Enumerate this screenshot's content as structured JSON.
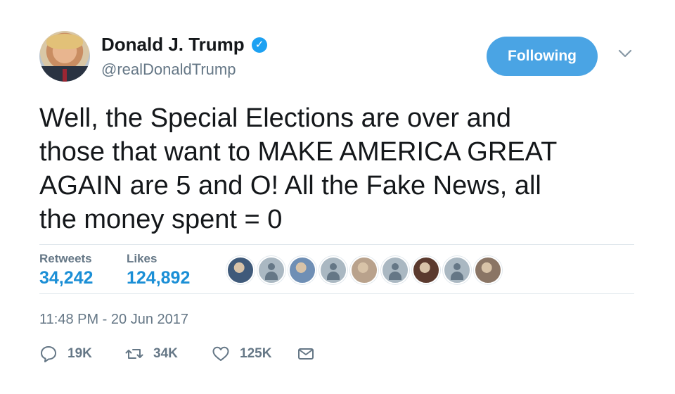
{
  "user": {
    "name": "Donald J. Trump",
    "handle": "@realDonaldTrump",
    "verified_glyph": "✓"
  },
  "follow": {
    "label": "Following"
  },
  "tweet": {
    "text": "Well, the Special Elections are over and\nthose that want to MAKE AMERICA GREAT\nAGAIN are 5 and O! All the Fake News, all\nthe money spent = 0"
  },
  "stats": {
    "retweets_label": "Retweets",
    "retweets_value": "34,242",
    "likes_label": "Likes",
    "likes_value": "124,892"
  },
  "likers": [
    {
      "kind": "photo",
      "color": "#3f5a7a"
    },
    {
      "kind": "default"
    },
    {
      "kind": "photo",
      "color": "#6f8fb5"
    },
    {
      "kind": "default"
    },
    {
      "kind": "photo",
      "color": "#b9a28c"
    },
    {
      "kind": "default"
    },
    {
      "kind": "photo",
      "color": "#5b3a2e"
    },
    {
      "kind": "default"
    },
    {
      "kind": "photo",
      "color": "#8a7565"
    }
  ],
  "timestamp": "11:48 PM - 20 Jun 2017",
  "actions": {
    "reply_count": "19K",
    "retweet_count": "34K",
    "like_count": "125K"
  },
  "colors": {
    "accent": "#1da1f2",
    "follow_button": "#4aa4e4",
    "stat_value": "#1b8fd6",
    "muted": "#657786"
  }
}
